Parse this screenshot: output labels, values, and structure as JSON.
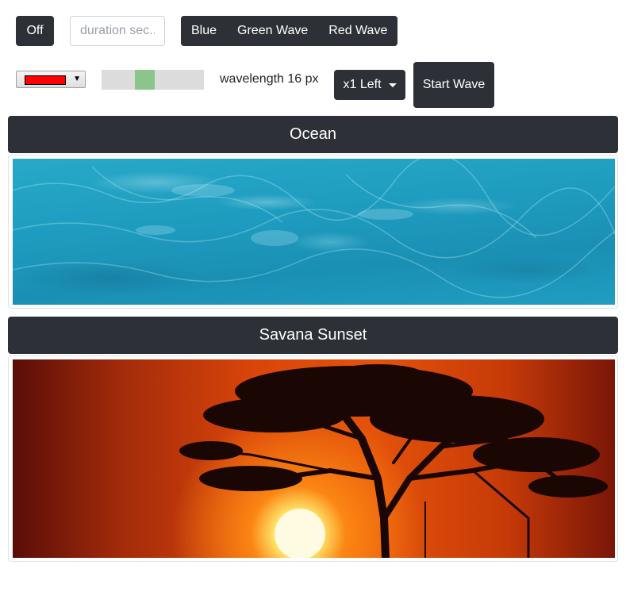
{
  "controls": {
    "off_label": "Off",
    "duration_placeholder": "duration sec..",
    "duration_value": "",
    "color_buttons": [
      "Blue",
      "Green Wave",
      "Red Wave"
    ],
    "color_select": {
      "selected_color": "#ff0000"
    },
    "slider": {
      "value_fraction": 0.4
    },
    "wavelength_label": "wavelength 16 px",
    "direction_label": "x1 Left",
    "start_label": "Start Wave"
  },
  "panels": [
    {
      "title": "Ocean",
      "image": "ocean-water-texture"
    },
    {
      "title": "Savana Sunset",
      "image": "acacia-tree-sunset"
    }
  ],
  "colors": {
    "dark_button": "#2d3137",
    "slider_track": "#dcdcdc",
    "slider_thumb": "#8bc58b"
  }
}
